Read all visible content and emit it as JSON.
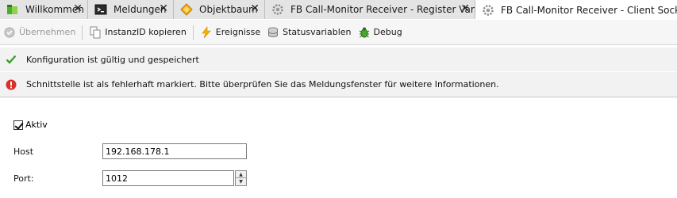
{
  "tabs": [
    {
      "label": "Willkommen",
      "icon": "welcome-icon",
      "close": "✕"
    },
    {
      "label": "Meldungen",
      "icon": "messages-icon",
      "close": "✕"
    },
    {
      "label": "Objektbaum",
      "icon": "object-tree-icon",
      "close": "✕"
    },
    {
      "label": "FB Call-Monitor Receiver - Register Variable",
      "icon": "gear-icon",
      "close": "✕"
    },
    {
      "label": "FB Call-Monitor Receiver - Client Socket",
      "icon": "gear-icon",
      "active": true
    }
  ],
  "toolbar": {
    "apply_label": "Übernehmen",
    "copy_id_label": "InstanzID kopieren",
    "events_label": "Ereignisse",
    "status_vars_label": "Statusvariablen",
    "debug_label": "Debug"
  },
  "messages": {
    "ok": "Konfiguration ist gültig und gespeichert",
    "error": "Schnittstelle ist als fehlerhaft markiert. Bitte überprüfen Sie das Meldungsfenster für weitere Informationen."
  },
  "form": {
    "active_label": "Aktiv",
    "active_checked": true,
    "host_label": "Host",
    "host_value": "192.168.178.1",
    "port_label": "Port:",
    "port_value": "1012"
  },
  "colors": {
    "ok_green": "#3fa02c",
    "error_red": "#d9302a"
  }
}
